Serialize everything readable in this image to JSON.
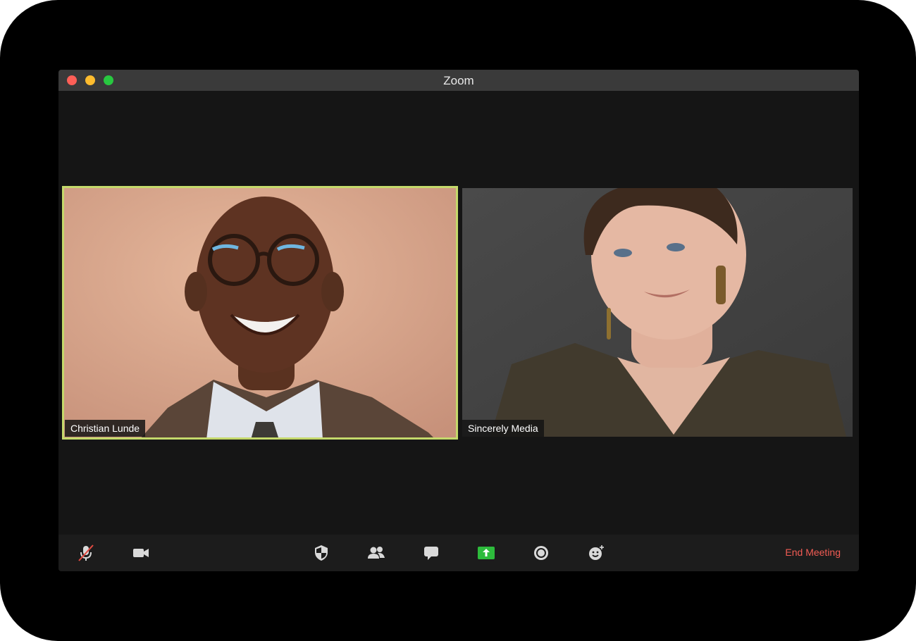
{
  "window": {
    "title": "Zoom"
  },
  "participants": [
    {
      "name": "Christian Lunde",
      "active_speaker": true
    },
    {
      "name": "Sincerely Media",
      "active_speaker": false
    }
  ],
  "toolbar": {
    "buttons": [
      {
        "icon": "microphone-muted-icon",
        "label": ""
      },
      {
        "icon": "video-camera-icon",
        "label": ""
      },
      {
        "icon": "security-shield-icon",
        "label": ""
      },
      {
        "icon": "participants-icon",
        "label": ""
      },
      {
        "icon": "chat-icon",
        "label": ""
      },
      {
        "icon": "share-screen-icon",
        "label": ""
      },
      {
        "icon": "record-icon",
        "label": ""
      },
      {
        "icon": "reactions-icon",
        "label": ""
      }
    ],
    "end_meeting_label": "End Meeting"
  },
  "colors": {
    "active_speaker_border": "#c4d96b",
    "share_screen": "#2dbb3c",
    "end_meeting": "#f25c54",
    "titlebar": "#3a3a3a",
    "background": "#151515"
  }
}
